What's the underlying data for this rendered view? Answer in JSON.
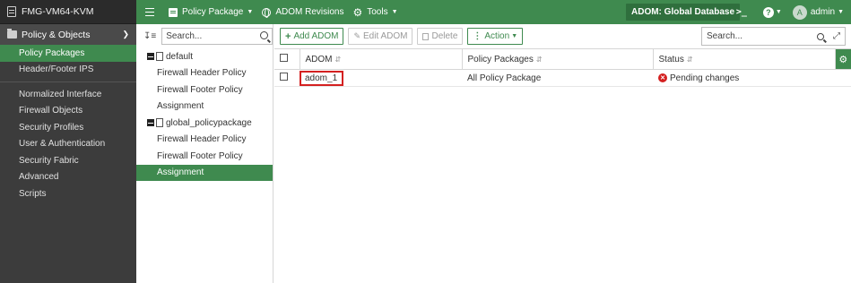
{
  "device": {
    "name": "FMG-VM64-KVM"
  },
  "sidebar": {
    "section_label": "Policy & Objects",
    "items": [
      {
        "label": "Policy Packages"
      },
      {
        "label": "Header/Footer IPS"
      },
      {
        "label": "Normalized Interface"
      },
      {
        "label": "Firewall Objects"
      },
      {
        "label": "Security Profiles"
      },
      {
        "label": "User & Authentication"
      },
      {
        "label": "Security Fabric"
      },
      {
        "label": "Advanced"
      },
      {
        "label": "Scripts"
      }
    ]
  },
  "topbar": {
    "policy_package": "Policy Package",
    "adom_revisions": "ADOM Revisions",
    "tools": "Tools",
    "adom_label": "ADOM: Global Database",
    "terminal": ">_",
    "help": "?",
    "avatar_letter": "A",
    "user": "admin"
  },
  "tree": {
    "search_placeholder": "Search...",
    "nodes": [
      {
        "label": "default"
      },
      {
        "label": "Firewall Header Policy"
      },
      {
        "label": "Firewall Footer Policy"
      },
      {
        "label": "Assignment"
      },
      {
        "label": "global_policypackage"
      },
      {
        "label": "Firewall Header Policy"
      },
      {
        "label": "Firewall Footer Policy"
      },
      {
        "label": "Assignment"
      }
    ]
  },
  "toolbar": {
    "add_adom": "Add ADOM",
    "edit_adom": "Edit ADOM",
    "delete": "Delete",
    "action": "Action",
    "search_placeholder": "Search..."
  },
  "table": {
    "columns": [
      "ADOM",
      "Policy Packages",
      "Status"
    ],
    "rows": [
      {
        "adom": "adom_1",
        "policy_packages": "All Policy Package",
        "status": "Pending changes"
      }
    ]
  },
  "colors": {
    "accent": "#3f8a4f",
    "sidebar_bg": "#3c3c3c",
    "error": "#d42020"
  }
}
